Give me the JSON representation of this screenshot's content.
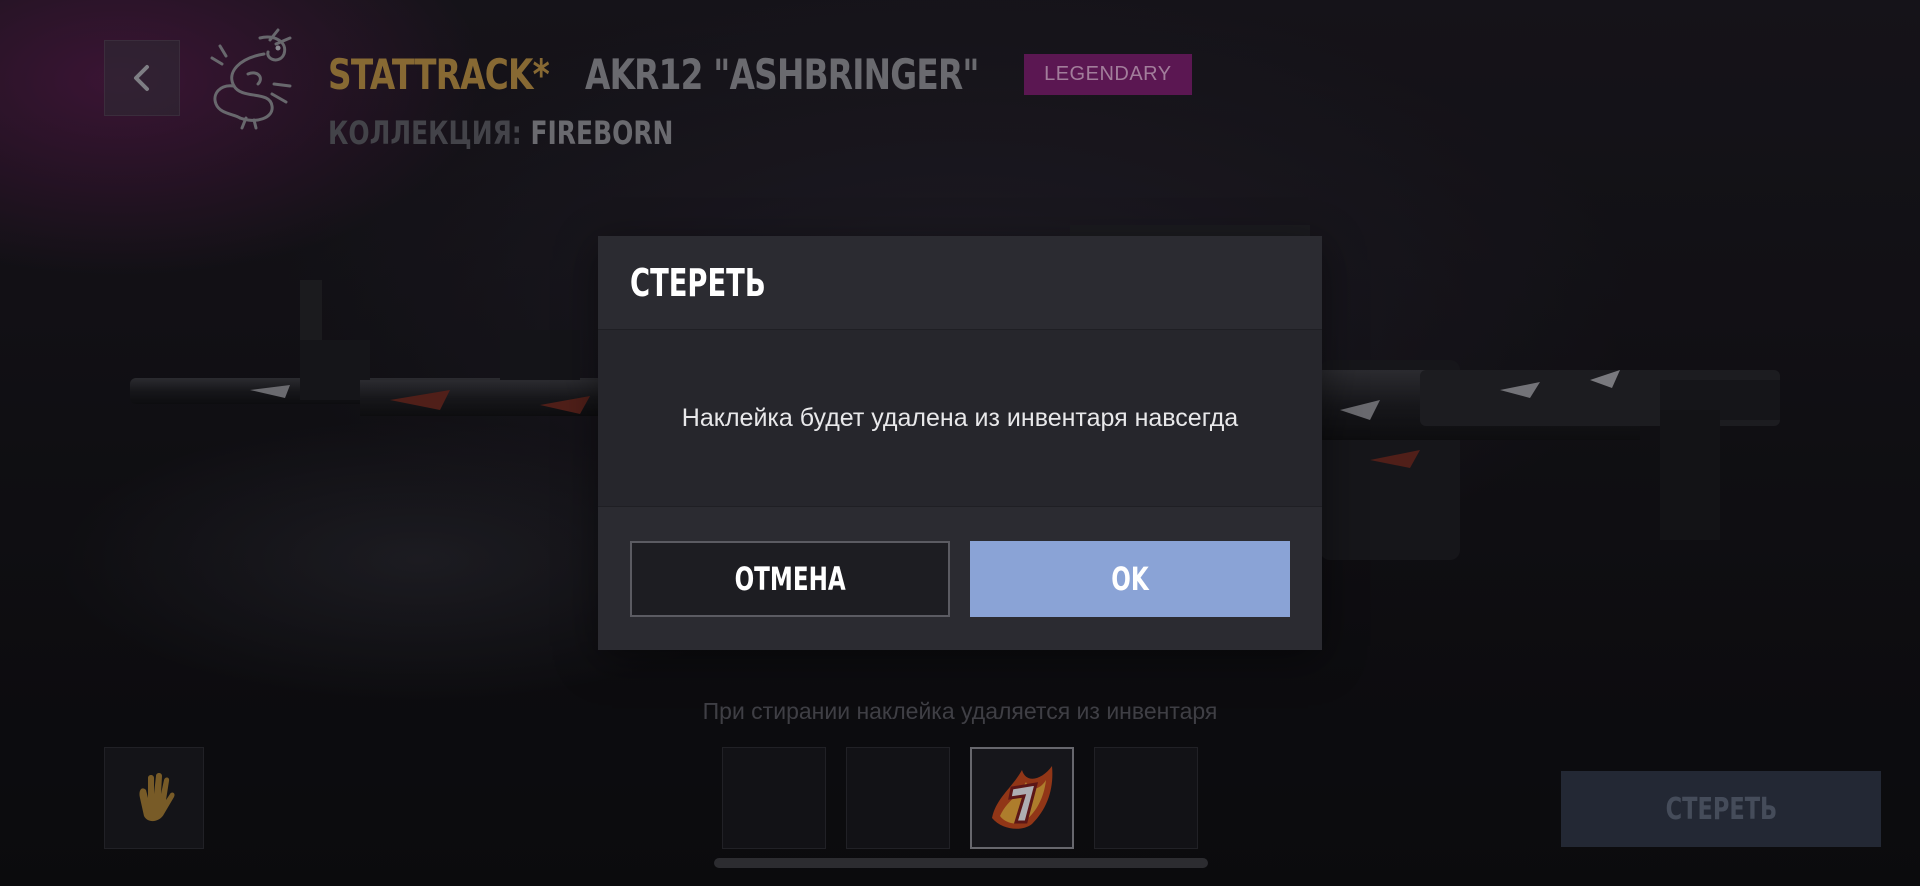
{
  "header": {
    "stattrack_label": "STATTRACK*",
    "weapon_name": "AKR12 \"ASHBRINGER\"",
    "rarity": "LEGENDARY",
    "collection_label": "КОЛЛЕКЦИЯ:",
    "collection_value": "FIREBORN"
  },
  "colors": {
    "stattrack": "#b58c45",
    "rarity_badge": "#7a1f6e",
    "ok_button": "#8aa3d6"
  },
  "hint_text": "При стирании наклейка удаляется из инвентаря",
  "bottom": {
    "erase_button_label": "СТЕРЕТЬ",
    "sticker_slots": [
      {
        "state": "empty"
      },
      {
        "state": "empty"
      },
      {
        "state": "filled",
        "icon": "sticker-flame-icon"
      },
      {
        "state": "empty"
      }
    ],
    "glove_icon": "glove-icon"
  },
  "modal": {
    "title": "СТЕРЕТЬ",
    "message": "Наклейка будет удалена из инвентаря навсегда",
    "cancel_label": "ОТМЕНА",
    "ok_label": "OK"
  }
}
